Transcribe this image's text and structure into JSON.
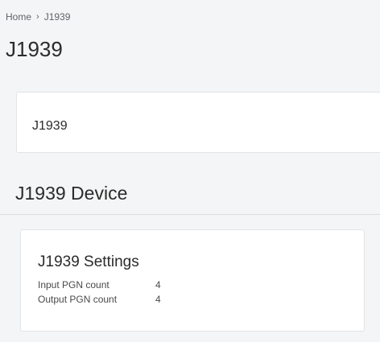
{
  "breadcrumb": {
    "home": "Home",
    "separator": "›",
    "current": "J1939"
  },
  "page": {
    "title": "J1939"
  },
  "top_card": {
    "label": "J1939"
  },
  "section": {
    "title": "J1939 Device"
  },
  "settings_card": {
    "title": "J1939 Settings",
    "rows": [
      {
        "label": "Input PGN count",
        "value": "4"
      },
      {
        "label": "Output PGN count",
        "value": "4"
      }
    ]
  }
}
